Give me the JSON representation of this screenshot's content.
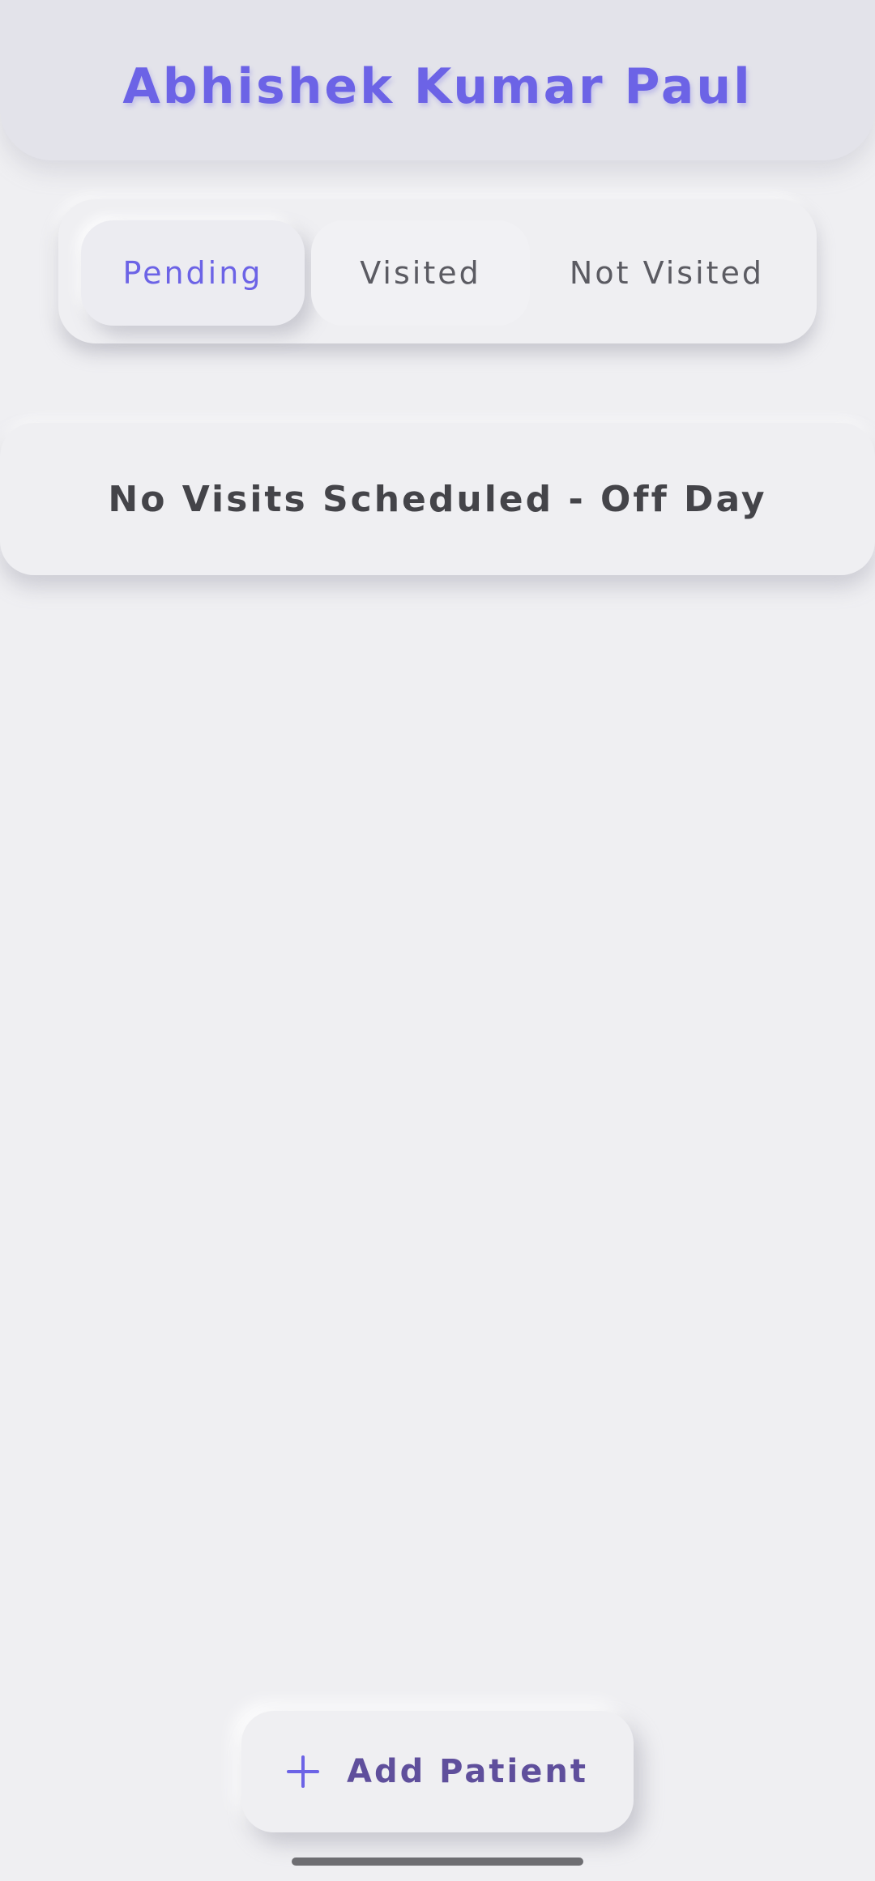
{
  "header": {
    "title": "Abhishek Kumar Paul"
  },
  "tabs": [
    {
      "label": "Pending",
      "active": true
    },
    {
      "label": "Visited",
      "active": false
    },
    {
      "label": "Not Visited",
      "active": false
    }
  ],
  "main": {
    "empty_message": "No Visits Scheduled - Off Day"
  },
  "actions": {
    "add_patient_label": "Add Patient",
    "add_patient_icon": "plus-icon"
  },
  "colors": {
    "accent": "#6c63e6",
    "background": "#efeff2",
    "header_background": "#e3e3ea",
    "text": "#444449"
  }
}
